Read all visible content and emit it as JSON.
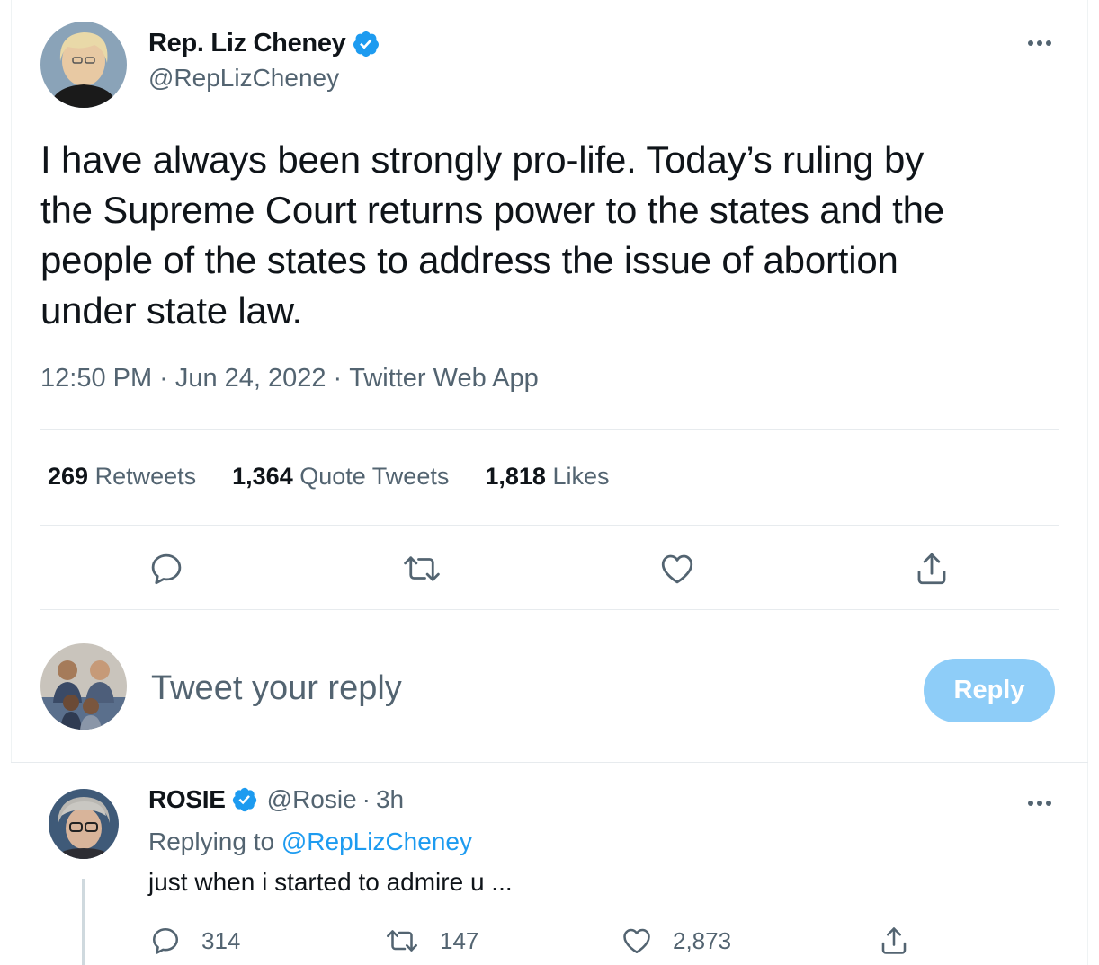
{
  "tweet": {
    "author_name": "Rep. Liz Cheney",
    "author_handle": "@RepLizCheney",
    "text": "I have always been strongly pro-life. Today’s ruling by\nthe Supreme Court returns power to the states and the\npeople of the states to address the issue of abortion\nunder state law.",
    "time": "12:50 PM",
    "date": "Jun 24, 2022",
    "source": "Twitter Web App",
    "separator": "·",
    "stats": {
      "retweets_count": "269",
      "retweets_label": "Retweets",
      "quotes_count": "1,364",
      "quotes_label": "Quote Tweets",
      "likes_count": "1,818",
      "likes_label": "Likes"
    }
  },
  "compose": {
    "placeholder": "Tweet your reply",
    "reply_button": "Reply"
  },
  "reply": {
    "author_name": "ROSIE",
    "author_handle": "@Rosie",
    "separator": "·",
    "time": "3h",
    "replying_prefix": "Replying to",
    "replying_to": "@RepLizCheney",
    "text": "just when i started to admire u ...",
    "reply_count": "314",
    "retweet_count": "147",
    "like_count": "2,873"
  },
  "colors": {
    "verified": "#1d9bf0",
    "muted_text": "#536471",
    "link": "#1d9bf0",
    "reply_button_bg": "#8ecdf8"
  },
  "icons": [
    "verified-badge-icon",
    "more-icon",
    "reply-icon",
    "retweet-icon",
    "like-icon",
    "share-icon"
  ]
}
